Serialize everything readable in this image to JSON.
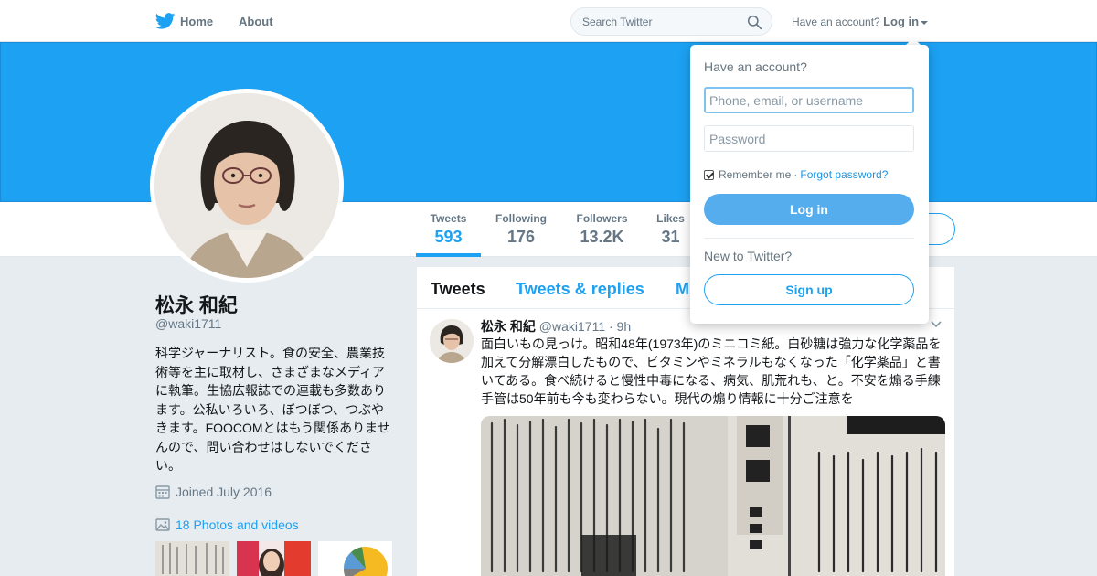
{
  "nav": {
    "home_label": "Home",
    "about_label": "About",
    "search_placeholder": "Search Twitter",
    "have_account": "Have an account?",
    "login_label": "Log in"
  },
  "profile": {
    "name": "松永 和紀",
    "handle": "@waki1711",
    "bio": "科学ジャーナリスト。食の安全、農業技術等を主に取材し、さまざまなメディアに執筆。生協広報誌での連載も多数あります。公私いろいろ、ぼつぼつ、つぶやきます。FOOCOMとはもう関係ありませんので、問い合わせはしないでください。",
    "joined": "Joined July 2016",
    "photos": "18 Photos and videos"
  },
  "stats": [
    {
      "label": "Tweets",
      "value": "593"
    },
    {
      "label": "Following",
      "value": "176"
    },
    {
      "label": "Followers",
      "value": "13.2K"
    },
    {
      "label": "Likes",
      "value": "31"
    }
  ],
  "timeline": {
    "tabs": [
      "Tweets",
      "Tweets & replies",
      "M"
    ],
    "tweet": {
      "name": "松永 和紀",
      "handle": "@waki1711",
      "time": "· 9h",
      "text": "面白いもの見っけ。昭和48年(1973年)のミニコミ紙。白砂糖は強力な化学薬品を加えて分解漂白したもので、ビタミンやミネラルもなくなった「化学薬品」と書いてある。食べ続けると慢性中毒になる、病気、肌荒れも、と。不安を煽る手練手管は50年前も今も変わらない。現代の煽り情報に十分ご注意を"
    }
  },
  "login_dropdown": {
    "title": "Have an account?",
    "username_placeholder": "Phone, email, or username",
    "password_placeholder": "Password",
    "remember_me": "Remember me",
    "separator": "·",
    "forgot_password": "Forgot password?",
    "login_button": "Log in",
    "new_to_twitter": "New to Twitter?",
    "signup_button": "Sign up"
  },
  "colors": {
    "brand": "#1da1f2",
    "background": "#e6ecf0",
    "muted": "#657786"
  },
  "icons": [
    "twitter-bird-icon",
    "search-icon",
    "caret-down-icon",
    "calendar-icon",
    "photo-icon",
    "chevron-down-icon"
  ]
}
